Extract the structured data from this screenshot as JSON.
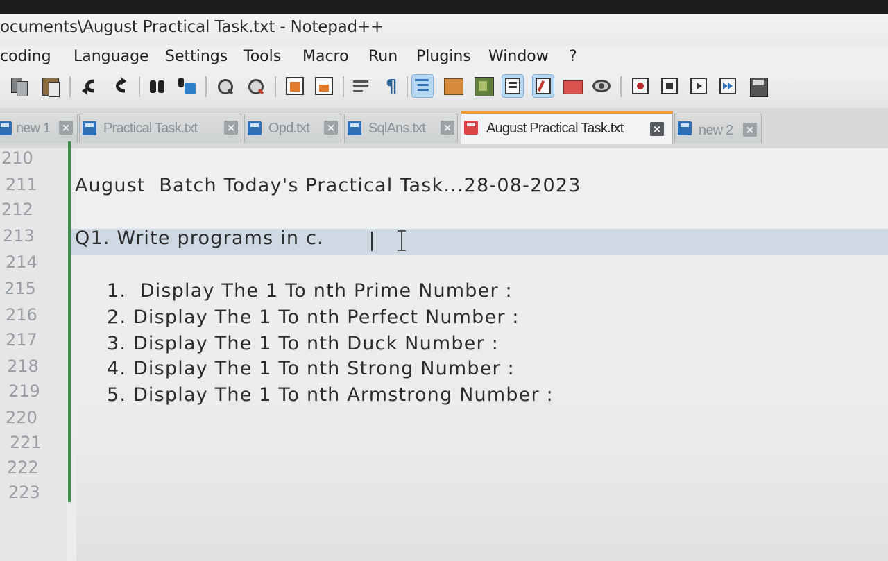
{
  "window": {
    "title": "ocuments\\August Practical Task.txt - Notepad++"
  },
  "menu": {
    "items": [
      {
        "label": "coding"
      },
      {
        "label": "Language"
      },
      {
        "label": "Settings"
      },
      {
        "label": "Tools"
      },
      {
        "label": "Macro"
      },
      {
        "label": "Run"
      },
      {
        "label": "Plugins"
      },
      {
        "label": "Window"
      },
      {
        "label": "?"
      }
    ]
  },
  "toolbar": {
    "icons": [
      "copy-icon",
      "paste-icon",
      "undo-icon",
      "redo-icon",
      "find-icon",
      "replace-icon",
      "zoom-in-icon",
      "zoom-out-icon",
      "sync-vertical-icon",
      "sync-horizontal-icon",
      "word-wrap-icon",
      "show-all-chars-icon",
      "indent-guide-icon",
      "udl-icon",
      "doc-map-icon",
      "function-list-icon",
      "folder-workspace-icon",
      "doc-list-icon",
      "monitoring-icon",
      "record-macro-icon",
      "stop-macro-icon",
      "play-macro-icon",
      "run-macro-multiple-icon",
      "save-macro-icon"
    ]
  },
  "tabs": [
    {
      "label": "new 1",
      "active": false
    },
    {
      "label": "Practical Task.txt",
      "active": false
    },
    {
      "label": "Opd.txt",
      "active": false
    },
    {
      "label": "SqlAns.txt",
      "active": false
    },
    {
      "label": "August Practical Task.txt",
      "active": true
    },
    {
      "label": "new 2",
      "active": false
    }
  ],
  "editor": {
    "line_numbers": [
      "210",
      "211",
      "212",
      "213",
      "214",
      "215",
      "216",
      "217",
      "218",
      "219",
      "220",
      "221",
      "222",
      "223"
    ],
    "lines": {
      "l211": "August  Batch Today's Practical Task...28-08-2023",
      "l213": "Q1. Write programs in c.",
      "l215": "1.  Display The 1 To nth Prime Number :",
      "l216": "2. Display The 1 To nth Perfect Number :",
      "l217": "3. Display The 1 To nth Duck Number :",
      "l218": "4. Display The 1 To nth Strong Number :",
      "l219": "5. Display The 1 To nth Armstrong Number :"
    }
  },
  "colors": {
    "active_tab_accent": "#f39a33",
    "change_bar": "#3f8f4c",
    "caret_line": "#cfd9e4"
  }
}
